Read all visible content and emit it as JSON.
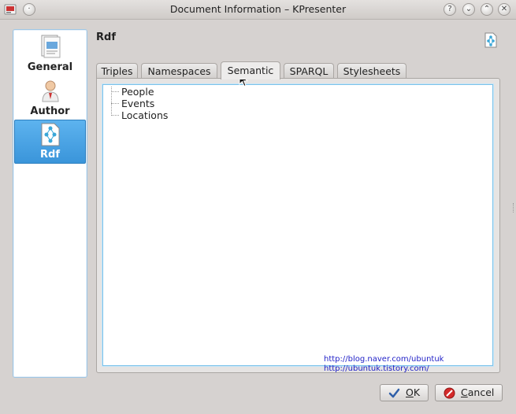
{
  "window": {
    "title": "Document Information – KPresenter",
    "controls": {
      "help": "?",
      "minimize": "⌄",
      "maximize": "⌃",
      "close": "✕"
    }
  },
  "sidebar": {
    "items": [
      {
        "label": "General",
        "icon": "document-icon",
        "active": false
      },
      {
        "label": "Author",
        "icon": "user-icon",
        "active": false
      },
      {
        "label": "Rdf",
        "icon": "rdf-icon",
        "active": true
      }
    ]
  },
  "page": {
    "title": "Rdf"
  },
  "tabs": [
    {
      "label": "Triples",
      "active": false
    },
    {
      "label": "Namespaces",
      "active": false
    },
    {
      "label": "Semantic",
      "active": true
    },
    {
      "label": "SPARQL",
      "active": false
    },
    {
      "label": "Stylesheets",
      "active": false
    }
  ],
  "tree": {
    "items": [
      "People",
      "Events",
      "Locations"
    ]
  },
  "watermark": {
    "line1": "http://blog.naver.com/ubuntuk",
    "line2": "http://ubuntuk.tistory.com/"
  },
  "buttons": {
    "ok": {
      "first": "O",
      "rest": "K"
    },
    "cancel": {
      "first": "C",
      "rest": "ancel"
    }
  },
  "colors": {
    "accent": "#3a95da",
    "tree_border": "#7cc2ea",
    "link": "#2323c8"
  }
}
